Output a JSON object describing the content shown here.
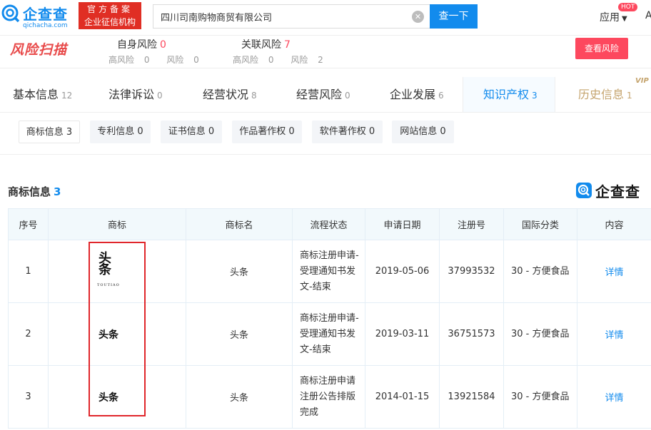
{
  "header": {
    "logo_name": "企查查",
    "logo_domain": "qichacha.com",
    "gov_badge_line1": "官方备案",
    "gov_badge_line2": "企业征信机构",
    "search_value": "四川司南购物商贸有限公司",
    "search_button": "查一下",
    "app_menu": "应用",
    "hot_badge": "HOT",
    "user_stub": "A"
  },
  "risk": {
    "logo": "风险扫描",
    "self": {
      "label": "自身风险",
      "count": "0",
      "high_label": "高风险",
      "high": "0",
      "risk_label": "风险",
      "risk": "0"
    },
    "related": {
      "label": "关联风险",
      "count": "7",
      "high_label": "高风险",
      "high": "0",
      "risk_label": "风险",
      "risk": "2"
    },
    "view_button": "查看风险"
  },
  "nav": {
    "tabs": [
      {
        "label": "基本信息",
        "count": "12"
      },
      {
        "label": "法律诉讼",
        "count": "0"
      },
      {
        "label": "经营状况",
        "count": "8"
      },
      {
        "label": "经营风险",
        "count": "0"
      },
      {
        "label": "企业发展",
        "count": "6"
      },
      {
        "label": "知识产权",
        "count": "3"
      },
      {
        "label": "历史信息",
        "count": "1"
      }
    ],
    "vip": "VIP"
  },
  "subtabs": [
    {
      "label": "商标信息 3"
    },
    {
      "label": "专利信息 0"
    },
    {
      "label": "证书信息 0"
    },
    {
      "label": "作品著作权 0"
    },
    {
      "label": "软件著作权 0"
    },
    {
      "label": "网站信息 0"
    }
  ],
  "section": {
    "title": "商标信息",
    "count": "3",
    "watermark": "企查查"
  },
  "table": {
    "headers": [
      "序号",
      "商标",
      "商标名",
      "流程状态",
      "申请日期",
      "注册号",
      "国际分类",
      "内容"
    ],
    "rows": [
      {
        "index": "1",
        "tm_text": "头条",
        "tm_sub": "TOUTIAO",
        "name": "头条",
        "status": "商标注册申请-受理通知书发文-结束",
        "date": "2019-05-06",
        "reg_no": "37993532",
        "class": "30 - 方便食品",
        "action": "详情"
      },
      {
        "index": "2",
        "tm_text": "头条",
        "tm_sub": "",
        "name": "头条",
        "status": "商标注册申请-受理通知书发文-结束",
        "date": "2019-03-11",
        "reg_no": "36751573",
        "class": "30 - 方便食品",
        "action": "详情"
      },
      {
        "index": "3",
        "tm_text": "头条",
        "tm_sub": "",
        "name": "头条",
        "status": "商标注册申请注册公告排版完成",
        "date": "2014-01-15",
        "reg_no": "13921584",
        "class": "30 - 方便食品",
        "action": "详情"
      }
    ]
  },
  "colors": {
    "brand": "#128bed",
    "risk_red": "#fd485e",
    "badge_red": "#e02e24",
    "history_gold": "#c5a46e",
    "highlight_box": "#e0262b"
  }
}
